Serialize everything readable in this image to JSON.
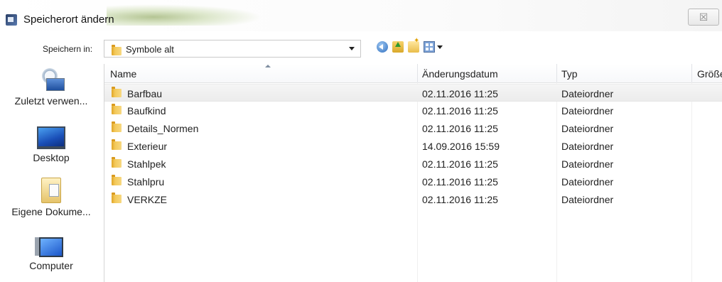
{
  "window": {
    "title": "Speicherort ändern",
    "close_glyph": "☒"
  },
  "location": {
    "label": "Speichern in:",
    "value": "Symbole alt"
  },
  "places": [
    {
      "label": "Zuletzt verwen...",
      "icon": "recent-places-icon"
    },
    {
      "label": "Desktop",
      "icon": "desktop-icon"
    },
    {
      "label": "Eigene Dokume...",
      "icon": "documents-icon"
    },
    {
      "label": "Computer",
      "icon": "computer-icon"
    }
  ],
  "columns": {
    "name": "Name",
    "date": "Änderungsdatum",
    "type": "Typ",
    "size": "Größe"
  },
  "files": [
    {
      "name": "Barfbau",
      "date": "02.11.2016 11:25",
      "type": "Dateiordner"
    },
    {
      "name": "Baufkind",
      "date": "02.11.2016 11:25",
      "type": "Dateiordner"
    },
    {
      "name": "Details_Normen",
      "date": "02.11.2016 11:25",
      "type": "Dateiordner"
    },
    {
      "name": "Exterieur",
      "date": "14.09.2016 15:59",
      "type": "Dateiordner"
    },
    {
      "name": "Stahlpek",
      "date": "02.11.2016 11:25",
      "type": "Dateiordner"
    },
    {
      "name": "Stahlpru",
      "date": "02.11.2016 11:25",
      "type": "Dateiordner"
    },
    {
      "name": "VERKZE",
      "date": "02.11.2016 11:25",
      "type": "Dateiordner"
    }
  ]
}
